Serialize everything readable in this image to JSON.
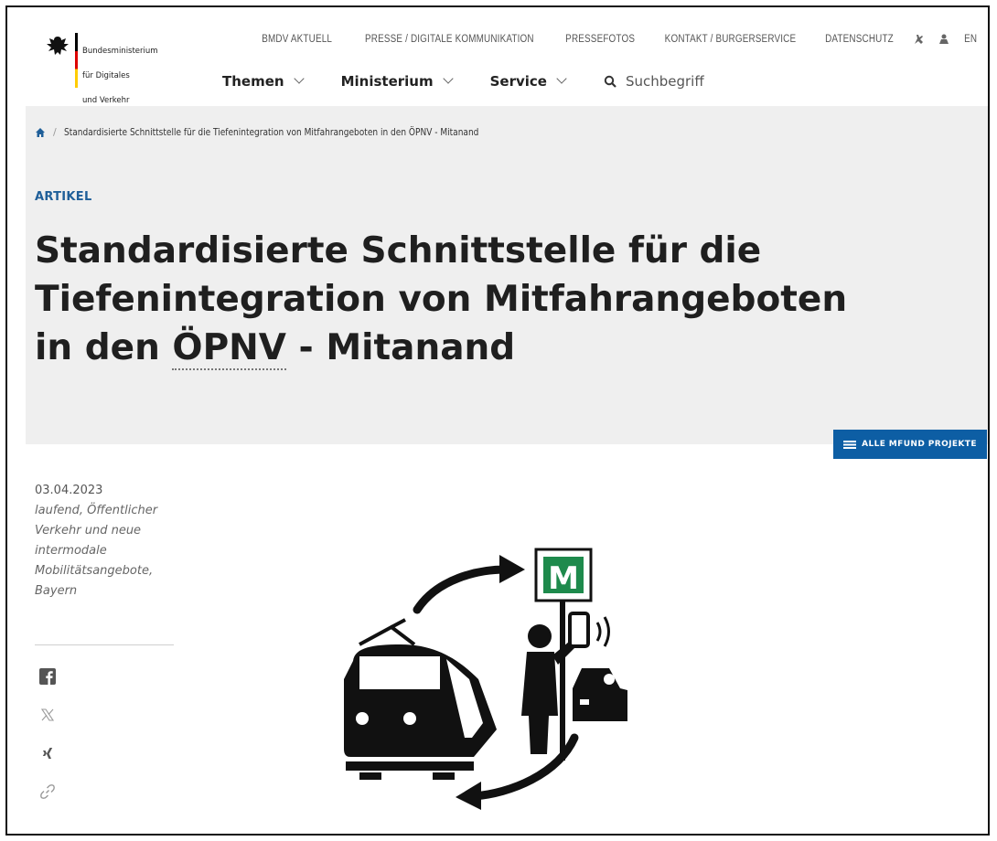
{
  "logo": {
    "text_lines": [
      "Bundesministerium",
      "für Digitales",
      "und Verkehr"
    ]
  },
  "top_nav": {
    "items": [
      "BMDV AKTUELL",
      "PRESSE / DIGITALE KOMMUNIKATION",
      "PRESSEFOTOS",
      "KONTAKT / BÜRGERSERVICE",
      "DATENSCHUTZ"
    ],
    "lang": "EN"
  },
  "main_nav": {
    "items": [
      "Themen",
      "Ministerium",
      "Service"
    ],
    "search_placeholder": "Suchbegriff"
  },
  "breadcrumb": {
    "current": "Standardisierte Schnittstelle für die Tiefenintegration von Mitfahrangeboten in den ÖPNV - Mitanand"
  },
  "article": {
    "kicker": "ARTIKEL",
    "title_line1": "Standardisierte Schnittstelle für die",
    "title_line2": "Tiefenintegration von Mitfahrangeboten",
    "title_line3_pre": "in den ",
    "title_abbr": "ÖPNV",
    "title_line3_post": " - Mitanand",
    "date": "03.04.2023",
    "tags": "laufend, Öffentlicher Verkehr und neue intermodale Mobilitätsangebote, Bayern"
  },
  "projects_button": "ALLE MFUND PROJEKTE",
  "illustration": {
    "sign_letter": "M",
    "sign_color": "#1e8a4c"
  },
  "colors": {
    "accent": "#0d5ea4",
    "hero_bg": "#efefef",
    "kicker": "#1f5f99"
  }
}
